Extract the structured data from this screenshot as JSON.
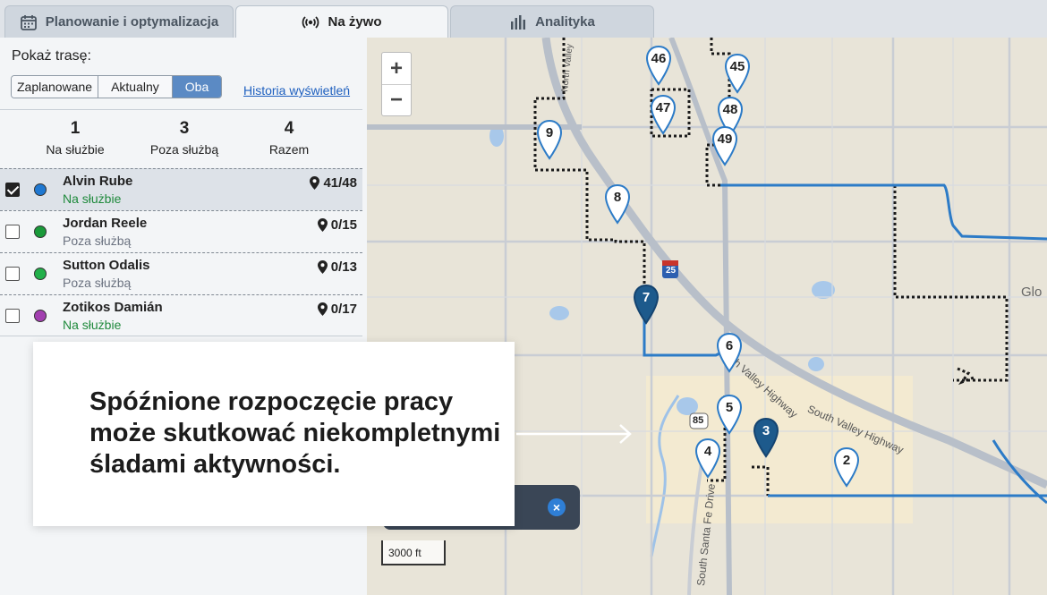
{
  "tabs": [
    {
      "label": "Planowanie i optymalizacja",
      "icon": "calendar-icon",
      "active": false
    },
    {
      "label": "Na żywo",
      "icon": "live-broadcast-icon",
      "active": true
    },
    {
      "label": "Analityka",
      "icon": "bar-chart-icon",
      "active": false
    }
  ],
  "sidebar": {
    "show_route_label": "Pokaż trasę:",
    "route_options": [
      "Zaplanowane",
      "Aktualny",
      "Oba"
    ],
    "selected_option": "Oba",
    "history_link": "Historia wyświetleń",
    "stats": [
      {
        "value": "1",
        "label": "Na służbie"
      },
      {
        "value": "3",
        "label": "Poza służbą"
      },
      {
        "value": "4",
        "label": "Razem"
      }
    ],
    "workers": [
      {
        "name": "Alvin Rube",
        "status": "Na służbie",
        "count": "41/48",
        "color": "#1f78d1",
        "checked": true,
        "status_color": "#1f8a3c"
      },
      {
        "name": "Jordan Reele",
        "status": "Poza służbą",
        "count": "0/15",
        "color": "#1a9a3a",
        "checked": false,
        "status_color": "#6b7280"
      },
      {
        "name": "Sutton Odalis",
        "status": "Poza służbą",
        "count": "0/13",
        "color": "#22b04a",
        "checked": false,
        "status_color": "#6b7280"
      },
      {
        "name": "Zotikos Damián",
        "status": "Na służbie",
        "count": "0/17",
        "color": "#a23fb0",
        "checked": false,
        "status_color": "#1f8a3c"
      }
    ]
  },
  "map": {
    "zoom_in": "+",
    "zoom_out": "−",
    "scale_label": "3000 ft",
    "street_labels": {
      "south_valley_highway": "South Valley Highway",
      "south_santa_fe": "South Santa Fe Drive",
      "north_valley": "North Valley",
      "glo": "Glo",
      "hw25": "25",
      "hw85": "85"
    },
    "markers": [
      {
        "label": "46",
        "dark": false
      },
      {
        "label": "45",
        "dark": false
      },
      {
        "label": "47",
        "dark": false
      },
      {
        "label": "48",
        "dark": false
      },
      {
        "label": "9",
        "dark": false
      },
      {
        "label": "49",
        "dark": false
      },
      {
        "label": "8",
        "dark": false
      },
      {
        "label": "7",
        "dark": true
      },
      {
        "label": "6",
        "dark": false
      },
      {
        "label": "5",
        "dark": false
      },
      {
        "label": "3",
        "dark": true
      },
      {
        "label": "4",
        "dark": false
      },
      {
        "label": "2",
        "dark": false
      }
    ],
    "close_button": "×"
  },
  "callout": {
    "text": "Spóźnione rozpoczęcie pracy może skutkować niekompletnymi śladami aktywności."
  }
}
